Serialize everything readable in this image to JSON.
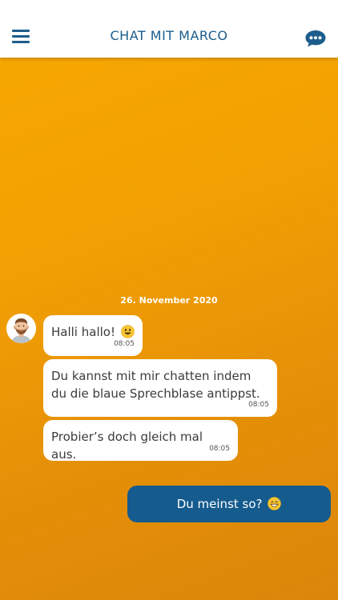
{
  "header": {
    "title": "CHAT MIT MARCO",
    "menu_icon": "hamburger-menu-icon",
    "chat_icon": "chat-bubble-icon",
    "accent_color": "#1c5d8c"
  },
  "chat": {
    "date_separator": "26. November 2020",
    "contact_avatar": "bearded-man-avatar",
    "messages": [
      {
        "sender": "Marco",
        "text": "Halli hallo!",
        "emoji": "smiley-face",
        "time": "08:05"
      },
      {
        "sender": "Marco",
        "text": "Du kannst mit mir chatten indem du die blaue Sprechblase antippst.",
        "time": "08:05"
      },
      {
        "sender": "Marco",
        "text": "Probier’s doch gleich mal aus.",
        "time": "08:05"
      }
    ],
    "outgoing": {
      "text": "Du meinst so?",
      "emoji": "grinning-sweat-face"
    }
  },
  "colors": {
    "background_top": "#f7a800",
    "background_bottom": "#dc860b",
    "outgoing_bubble": "#155b8e",
    "incoming_bubble": "#ffffff"
  }
}
